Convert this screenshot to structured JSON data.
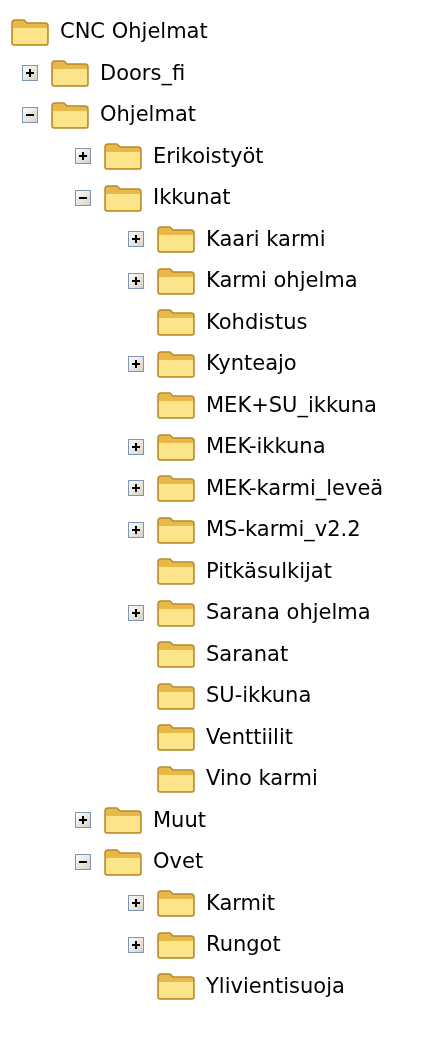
{
  "tree": {
    "label": "CNC Ohjelmat",
    "children": [
      {
        "label": "Doors_fi",
        "expandable": true,
        "expanded": false
      },
      {
        "label": "Ohjelmat",
        "expandable": true,
        "expanded": true,
        "children": [
          {
            "label": "Erikoistyöt",
            "expandable": true,
            "expanded": false
          },
          {
            "label": "Ikkunat",
            "expandable": true,
            "expanded": true,
            "children": [
              {
                "label": "Kaari karmi",
                "expandable": true,
                "expanded": false
              },
              {
                "label": "Karmi ohjelma",
                "expandable": true,
                "expanded": false
              },
              {
                "label": "Kohdistus",
                "expandable": false
              },
              {
                "label": "Kynteajo",
                "expandable": true,
                "expanded": false
              },
              {
                "label": "MEK+SU_ikkuna",
                "expandable": false
              },
              {
                "label": "MEK-ikkuna",
                "expandable": true,
                "expanded": false
              },
              {
                "label": "MEK-karmi_leveä",
                "expandable": true,
                "expanded": false
              },
              {
                "label": "MS-karmi_v2.2",
                "expandable": true,
                "expanded": false
              },
              {
                "label": "Pitkäsulkijat",
                "expandable": false
              },
              {
                "label": "Sarana ohjelma",
                "expandable": true,
                "expanded": false
              },
              {
                "label": "Saranat",
                "expandable": false
              },
              {
                "label": "SU-ikkuna",
                "expandable": false
              },
              {
                "label": "Venttiilit",
                "expandable": false
              },
              {
                "label": "Vino karmi",
                "expandable": false
              }
            ]
          },
          {
            "label": "Muut",
            "expandable": true,
            "expanded": false
          },
          {
            "label": "Ovet",
            "expandable": true,
            "expanded": true,
            "children": [
              {
                "label": "Karmit",
                "expandable": true,
                "expanded": false
              },
              {
                "label": "Rungot",
                "expandable": true,
                "expanded": false
              },
              {
                "label": "Ylivientisuoja",
                "expandable": false
              }
            ]
          }
        ]
      }
    ]
  }
}
